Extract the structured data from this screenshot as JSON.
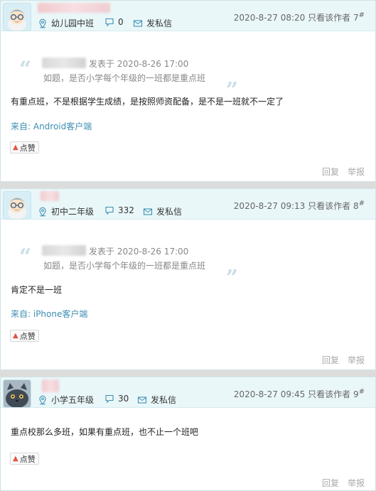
{
  "posts": [
    {
      "badge": "幼儿园中班",
      "reply_count": "0",
      "message_label": "发私信",
      "time": "2020-8-27 08:20",
      "only_author": "只看该作者",
      "floor": "7",
      "quote_meta": "发表于 2020-8-26 17:00",
      "quote_text": "如题，是否小学每个年级的一班都是重点班",
      "content": "有重点班，不是根据学生成绩，是按照师资配备，是不是一班就不一定了",
      "source": "来自: Android客户端",
      "like": "点赞",
      "reply": "回复",
      "report": "举报"
    },
    {
      "badge": "初中二年级",
      "reply_count": "332",
      "message_label": "发私信",
      "time": "2020-8-27 09:13",
      "only_author": "只看该作者",
      "floor": "8",
      "quote_meta": "发表于 2020-8-26 17:00",
      "quote_text": "如题，是否小学每个年级的一班都是重点班",
      "content": "肯定不是一班",
      "source": "来自: iPhone客户端",
      "like": "点赞",
      "reply": "回复",
      "report": "举报"
    },
    {
      "badge": "小学五年级",
      "reply_count": "30",
      "message_label": "发私信",
      "time": "2020-8-27 09:45",
      "only_author": "只看该作者",
      "floor": "9",
      "content": "重点校那么多班，如果有重点班，也不止一个班吧",
      "like": "点赞",
      "reply": "回复",
      "report": "举报"
    }
  ],
  "icons": {
    "badge": "location-pin-icon",
    "replies": "chat-bubble-icon",
    "message": "envelope-icon",
    "like": "thumbs-up-icon"
  },
  "colors": {
    "header_bg": "#eaf7f9",
    "icon": "#3d8fb2",
    "link": "#3d8fb2",
    "like_icon": "#e2533f"
  }
}
